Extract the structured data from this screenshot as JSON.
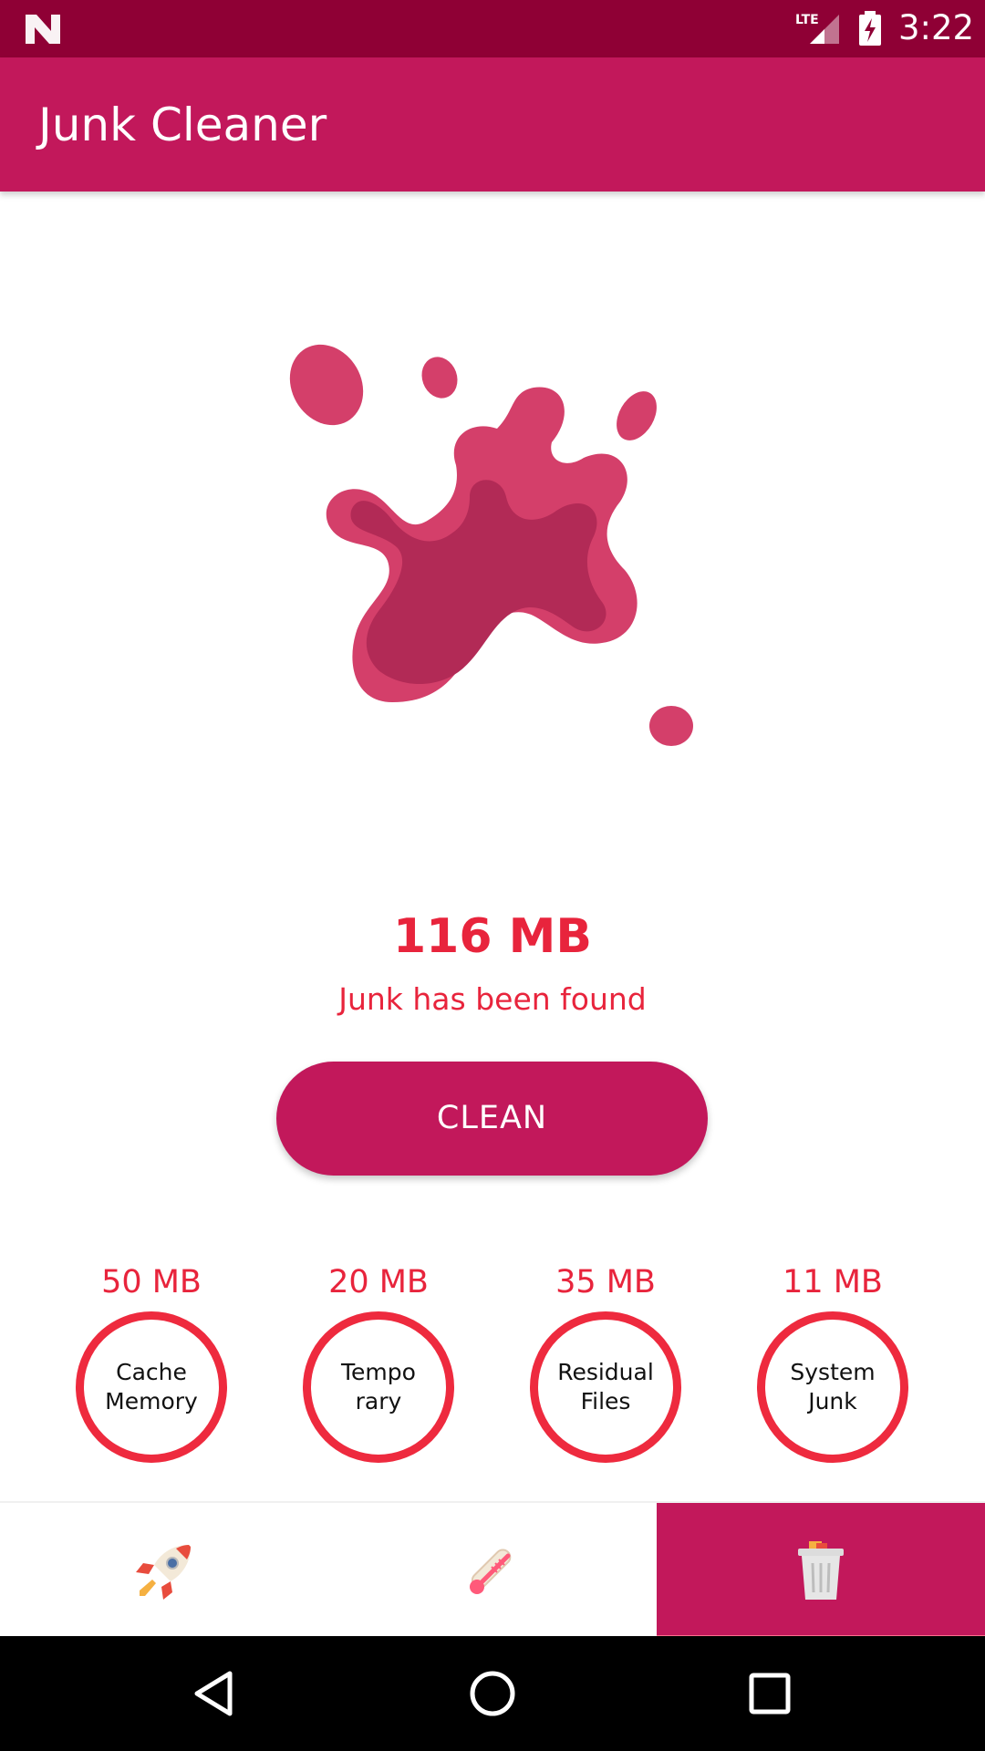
{
  "status_bar": {
    "network": "LTE",
    "time": "3:22"
  },
  "app_bar": {
    "title": "Junk Cleaner"
  },
  "summary": {
    "total_size": "116 MB",
    "message": "Junk has been found"
  },
  "clean_button": {
    "label": "CLEAN"
  },
  "categories": [
    {
      "size": "50 MB",
      "label": "Cache Memory"
    },
    {
      "size": "20 MB",
      "label": "Tempo rary"
    },
    {
      "size": "35 MB",
      "label": "Residual Files"
    },
    {
      "size": "11 MB",
      "label": "System Junk"
    }
  ],
  "bottom_nav": {
    "items": [
      {
        "icon": "rocket-icon",
        "active": false
      },
      {
        "icon": "thermometer-icon",
        "active": false
      },
      {
        "icon": "trash-can-icon",
        "active": true
      }
    ]
  },
  "colors": {
    "primary": "#c2185b",
    "status_bar": "#8f0035",
    "accent_red": "#e8243c",
    "splash_light": "#d43f6a",
    "splash_dark": "#b22a56"
  }
}
